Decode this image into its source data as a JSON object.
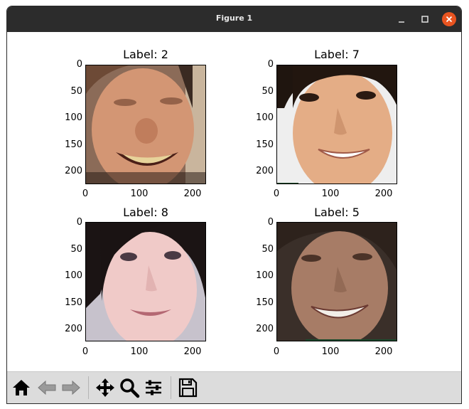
{
  "window": {
    "title": "Figure 1"
  },
  "figure": {
    "panels": [
      {
        "title": "Label: 2",
        "yticks": [
          "0",
          "50",
          "100",
          "150",
          "200"
        ],
        "xticks": [
          "0",
          "100",
          "200"
        ],
        "face_bg": "#8a6a52",
        "skin": "#d99a78",
        "hair": "#2a1a12"
      },
      {
        "title": "Label: 7",
        "yticks": [
          "0",
          "50",
          "100",
          "150",
          "200"
        ],
        "xticks": [
          "0",
          "100",
          "200"
        ],
        "face_bg": "#f0f0f0",
        "skin": "#e7b08a",
        "hair": "#1c120e"
      },
      {
        "title": "Label: 8",
        "yticks": [
          "0",
          "50",
          "100",
          "150",
          "200"
        ],
        "xticks": [
          "0",
          "100",
          "200"
        ],
        "face_bg": "#c9c3cf",
        "skin": "#eec8c6",
        "hair": "#1a1414"
      },
      {
        "title": "Label: 5",
        "yticks": [
          "0",
          "50",
          "100",
          "150",
          "200"
        ],
        "xticks": [
          "0",
          "100",
          "200"
        ],
        "face_bg": "#3a2e28",
        "skin": "#a67c66",
        "hair": "#2a1f1a"
      }
    ]
  },
  "toolbar": {
    "icons": [
      "home-icon",
      "back-icon",
      "forward-icon",
      "pan-icon",
      "zoom-icon",
      "configure-subplots-icon",
      "save-icon"
    ]
  }
}
